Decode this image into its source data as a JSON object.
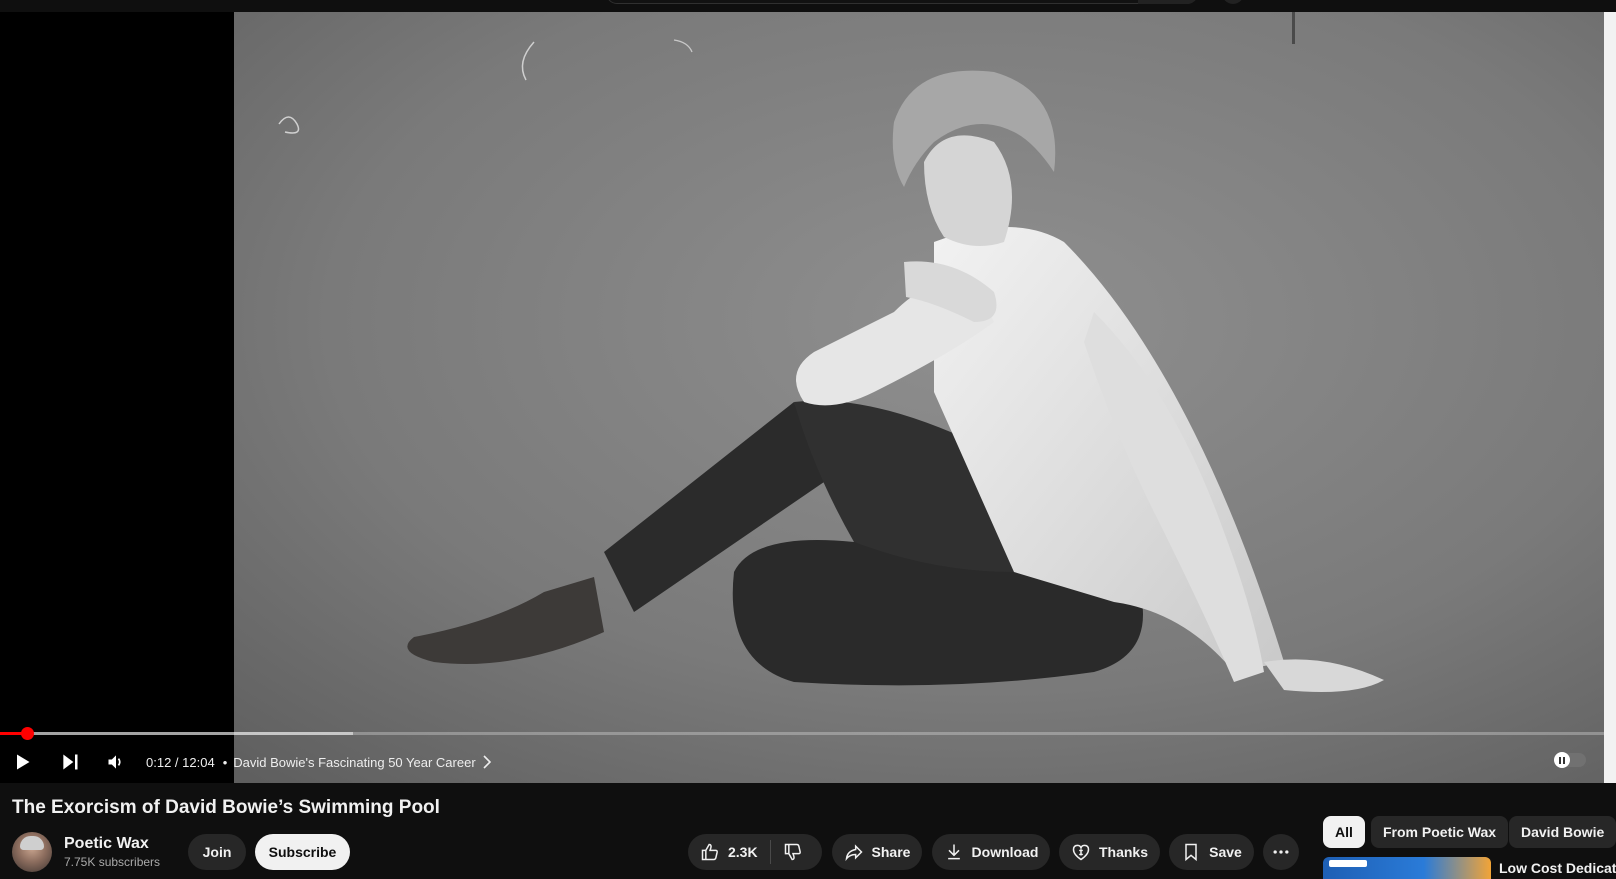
{
  "player": {
    "progress": {
      "played_fraction": 0.0166,
      "buffered_fraction": 0.22,
      "scrubber_fraction": 0.0166
    },
    "time_current": "0:12",
    "time_separator": " / ",
    "time_total": "12:04",
    "chapter_dot": "•",
    "chapter_title": "David Bowie's Fascinating 50 Year Career",
    "autoplay_on": false
  },
  "video": {
    "title": "The Exorcism of David Bowie’s Swimming Pool"
  },
  "channel": {
    "name": "Poetic Wax",
    "subscribers": "7.75K subscribers",
    "join_label": "Join",
    "subscribe_label": "Subscribe"
  },
  "actions": {
    "like_count": "2.3K",
    "share_label": "Share",
    "download_label": "Download",
    "thanks_label": "Thanks",
    "save_label": "Save"
  },
  "chips": {
    "all": "All",
    "from_channel": "From Poetic Wax",
    "topic": "David Bowie"
  },
  "recommendation": {
    "title": "Low Cost Dedicate"
  },
  "colors": {
    "accent": "#ff0000",
    "background": "#0f0f0f",
    "pill": "#272727"
  }
}
